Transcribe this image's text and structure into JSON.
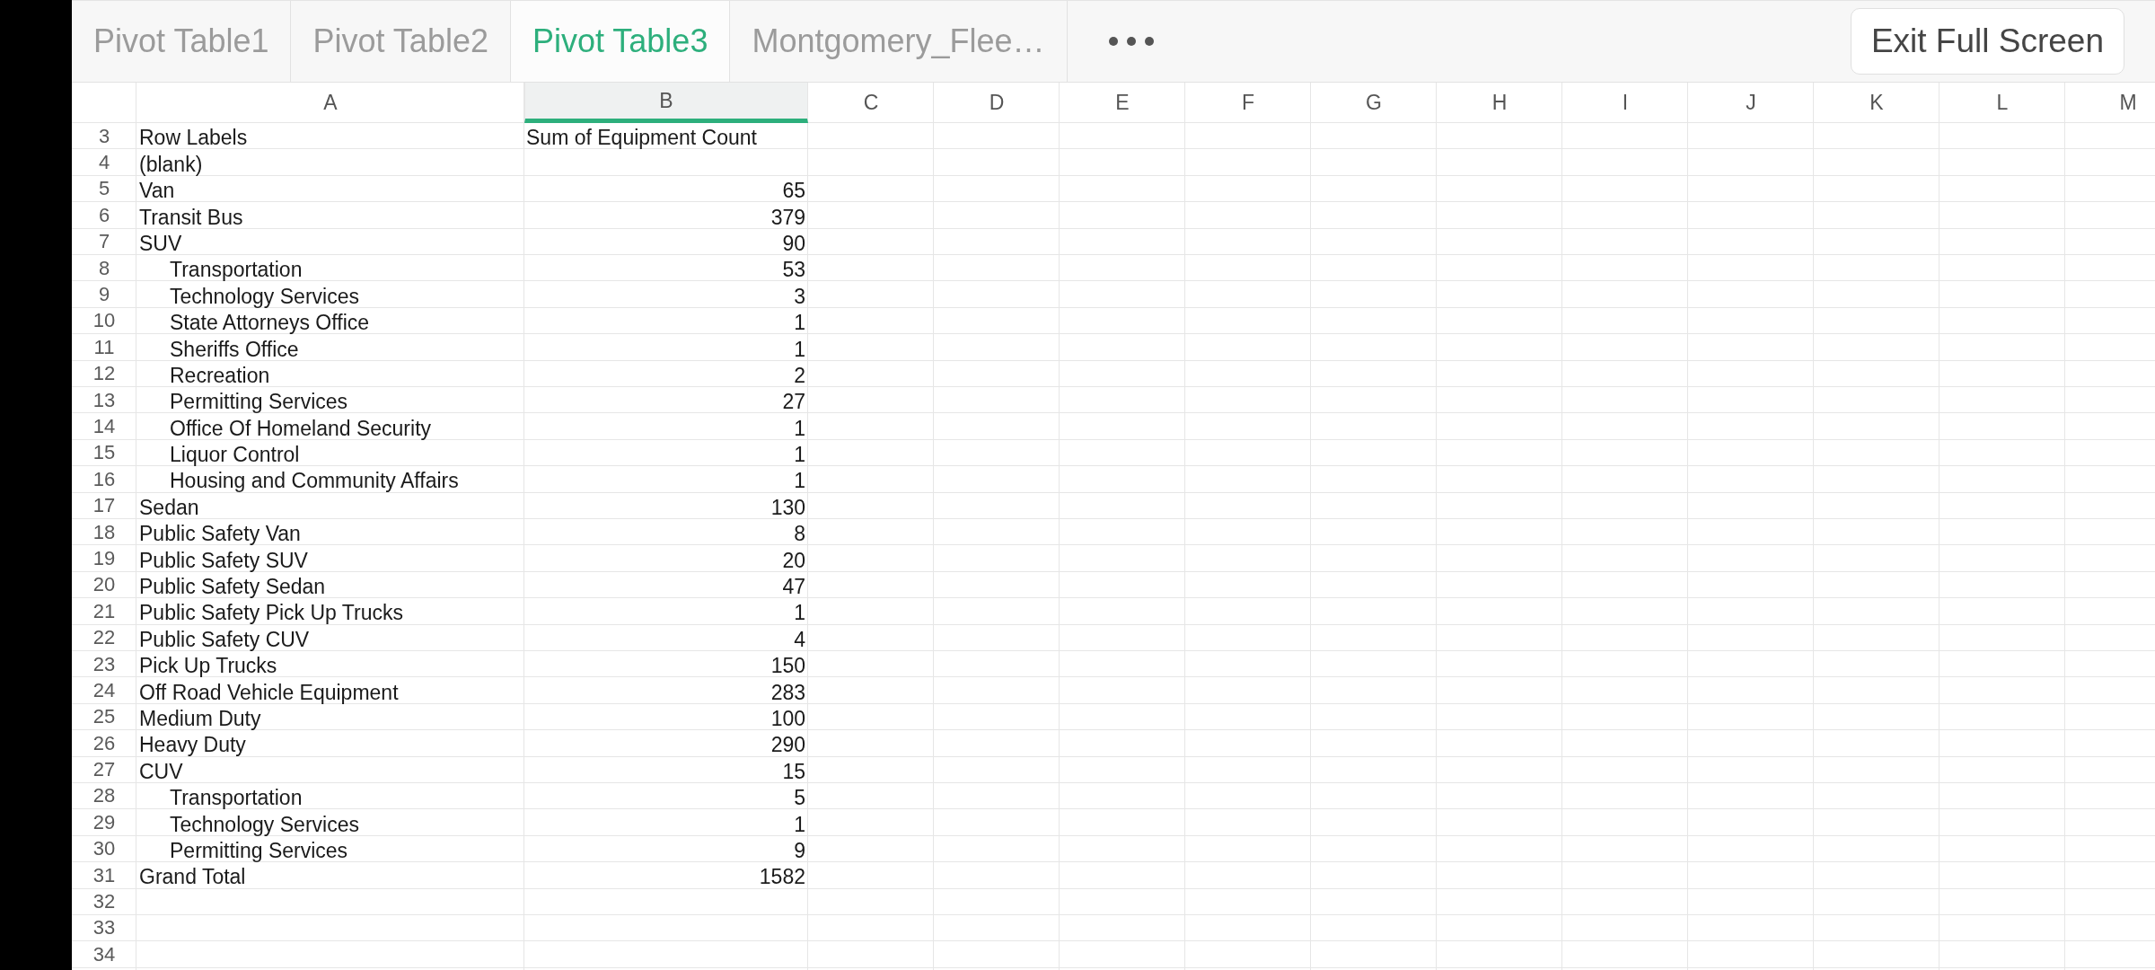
{
  "tabs": [
    {
      "label": "Pivot Table1",
      "selected": false
    },
    {
      "label": "Pivot Table2",
      "selected": false
    },
    {
      "label": "Pivot Table3",
      "selected": true
    },
    {
      "label": "Montgomery_Flee…",
      "selected": false
    }
  ],
  "exit_button": {
    "label": "Exit Full Screen"
  },
  "sheet": {
    "columns": [
      {
        "label": "A",
        "selected": false
      },
      {
        "label": "B",
        "selected": true
      },
      {
        "label": "C",
        "selected": false
      },
      {
        "label": "D",
        "selected": false
      },
      {
        "label": "E",
        "selected": false
      },
      {
        "label": "F",
        "selected": false
      },
      {
        "label": "G",
        "selected": false
      },
      {
        "label": "H",
        "selected": false
      },
      {
        "label": "I",
        "selected": false
      },
      {
        "label": "J",
        "selected": false
      },
      {
        "label": "K",
        "selected": false
      },
      {
        "label": "L",
        "selected": false
      },
      {
        "label": "M",
        "selected": false
      }
    ],
    "rows": [
      {
        "number": "3",
        "kind": "header",
        "label": "Row Labels",
        "heading": "Sum of Equipment Count"
      },
      {
        "number": "4",
        "kind": "data",
        "label": "(blank)"
      },
      {
        "number": "5",
        "kind": "data",
        "label": "Van",
        "value": "65"
      },
      {
        "number": "6",
        "kind": "data",
        "label": "Transit Bus",
        "value": "379"
      },
      {
        "number": "7",
        "kind": "data",
        "label": "SUV",
        "value": "90",
        "children": [
          {
            "number": "8",
            "kind": "data",
            "label": "Transportation",
            "value": "53"
          },
          {
            "number": "9",
            "kind": "data",
            "label": "Technology Services",
            "value": "3"
          },
          {
            "number": "10",
            "kind": "data",
            "label": "State Attorneys Office",
            "value": "1"
          },
          {
            "number": "11",
            "kind": "data",
            "label": "Sheriffs Office",
            "value": "1"
          },
          {
            "number": "12",
            "kind": "data",
            "label": "Recreation",
            "value": "2"
          },
          {
            "number": "13",
            "kind": "data",
            "label": "Permitting Services",
            "value": "27"
          },
          {
            "number": "14",
            "kind": "data",
            "label": "Office Of Homeland Security",
            "value": "1"
          },
          {
            "number": "15",
            "kind": "data",
            "label": "Liquor Control",
            "value": "1"
          },
          {
            "number": "16",
            "kind": "data",
            "label": "Housing and Community Affairs",
            "value": "1"
          }
        ]
      },
      {
        "number": "17",
        "kind": "data",
        "label": "Sedan",
        "value": "130"
      },
      {
        "number": "18",
        "kind": "data",
        "label": "Public Safety Van",
        "value": "8"
      },
      {
        "number": "19",
        "kind": "data",
        "label": "Public Safety SUV",
        "value": "20"
      },
      {
        "number": "20",
        "kind": "data",
        "label": "Public Safety Sedan",
        "value": "47"
      },
      {
        "number": "21",
        "kind": "data",
        "label": "Public Safety Pick Up Trucks",
        "value": "1"
      },
      {
        "number": "22",
        "kind": "data",
        "label": "Public Safety CUV",
        "value": "4"
      },
      {
        "number": "23",
        "kind": "data",
        "label": "Pick Up Trucks",
        "value": "150"
      },
      {
        "number": "24",
        "kind": "data",
        "label": "Off Road Vehicle Equipment",
        "value": "283"
      },
      {
        "number": "25",
        "kind": "data",
        "label": "Medium Duty",
        "value": "100"
      },
      {
        "number": "26",
        "kind": "data",
        "label": "Heavy Duty",
        "value": "290"
      },
      {
        "number": "27",
        "kind": "data",
        "label": "CUV",
        "value": "15",
        "children": [
          {
            "number": "28",
            "kind": "data",
            "label": "Transportation",
            "value": "5"
          },
          {
            "number": "29",
            "kind": "data",
            "label": "Technology Services",
            "value": "1"
          },
          {
            "number": "30",
            "kind": "data",
            "label": "Permitting Services",
            "value": "9"
          }
        ]
      },
      {
        "number": "31",
        "kind": "data",
        "label": "Grand Total",
        "value": "1582"
      },
      {
        "number": "32",
        "kind": "empty"
      },
      {
        "number": "33",
        "kind": "empty"
      },
      {
        "number": "34",
        "kind": "empty"
      }
    ]
  }
}
